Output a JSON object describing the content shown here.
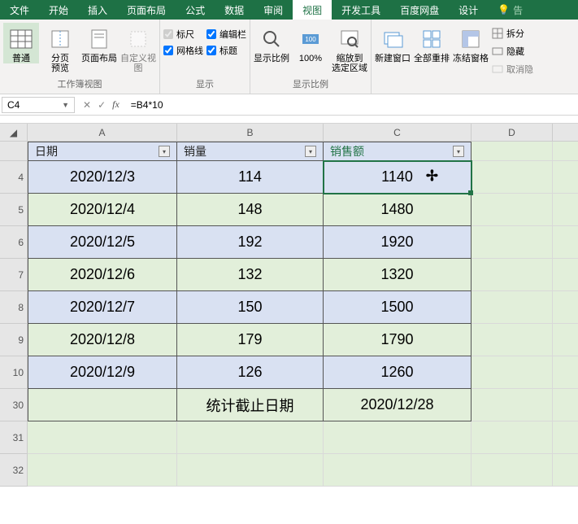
{
  "tabs": {
    "file": "文件",
    "home": "开始",
    "insert": "插入",
    "pagelayout": "页面布局",
    "formulas": "公式",
    "data": "数据",
    "review": "审阅",
    "view": "视图",
    "developer": "开发工具",
    "baidu": "百度网盘",
    "design": "设计",
    "tell": "告"
  },
  "ribbon": {
    "normal": "普通",
    "pagebreak": "分页\n预览",
    "pagelayout": "页面布局",
    "custom": "自定义视图",
    "group_views": "工作簿视图",
    "ruler": "标尺",
    "formulabar": "编辑栏",
    "gridlines": "网格线",
    "headings": "标题",
    "group_show": "显示",
    "zoom": "显示比例",
    "hundred": "100%",
    "zoomsel": "缩放到\n选定区域",
    "group_zoom": "显示比例",
    "newwin": "新建窗口",
    "arrange": "全部重排",
    "freeze": "冻结窗格",
    "split": "拆分",
    "hide": "隐藏",
    "unhide": "取消隐"
  },
  "formula_bar": {
    "namebox": "C4",
    "formula": "=B4*10"
  },
  "columns": [
    "A",
    "B",
    "C",
    "D"
  ],
  "headers": {
    "date": "日期",
    "qty": "销量",
    "amount": "销售额"
  },
  "rows": [
    {
      "n": "4",
      "date": "2020/12/3",
      "qty": "114",
      "amount": "1140",
      "band": "blue",
      "sel": true
    },
    {
      "n": "5",
      "date": "2020/12/4",
      "qty": "148",
      "amount": "1480",
      "band": "green"
    },
    {
      "n": "6",
      "date": "2020/12/5",
      "qty": "192",
      "amount": "1920",
      "band": "blue"
    },
    {
      "n": "7",
      "date": "2020/12/6",
      "qty": "132",
      "amount": "1320",
      "band": "green"
    },
    {
      "n": "8",
      "date": "2020/12/7",
      "qty": "150",
      "amount": "1500",
      "band": "blue"
    },
    {
      "n": "9",
      "date": "2020/12/8",
      "qty": "179",
      "amount": "1790",
      "band": "green"
    },
    {
      "n": "10",
      "date": "2020/12/9",
      "qty": "126",
      "amount": "1260",
      "band": "blue"
    }
  ],
  "summary": {
    "row": "30",
    "label": "统计截止日期",
    "value": "2020/12/28"
  },
  "tail_rows": [
    "31",
    "32"
  ]
}
